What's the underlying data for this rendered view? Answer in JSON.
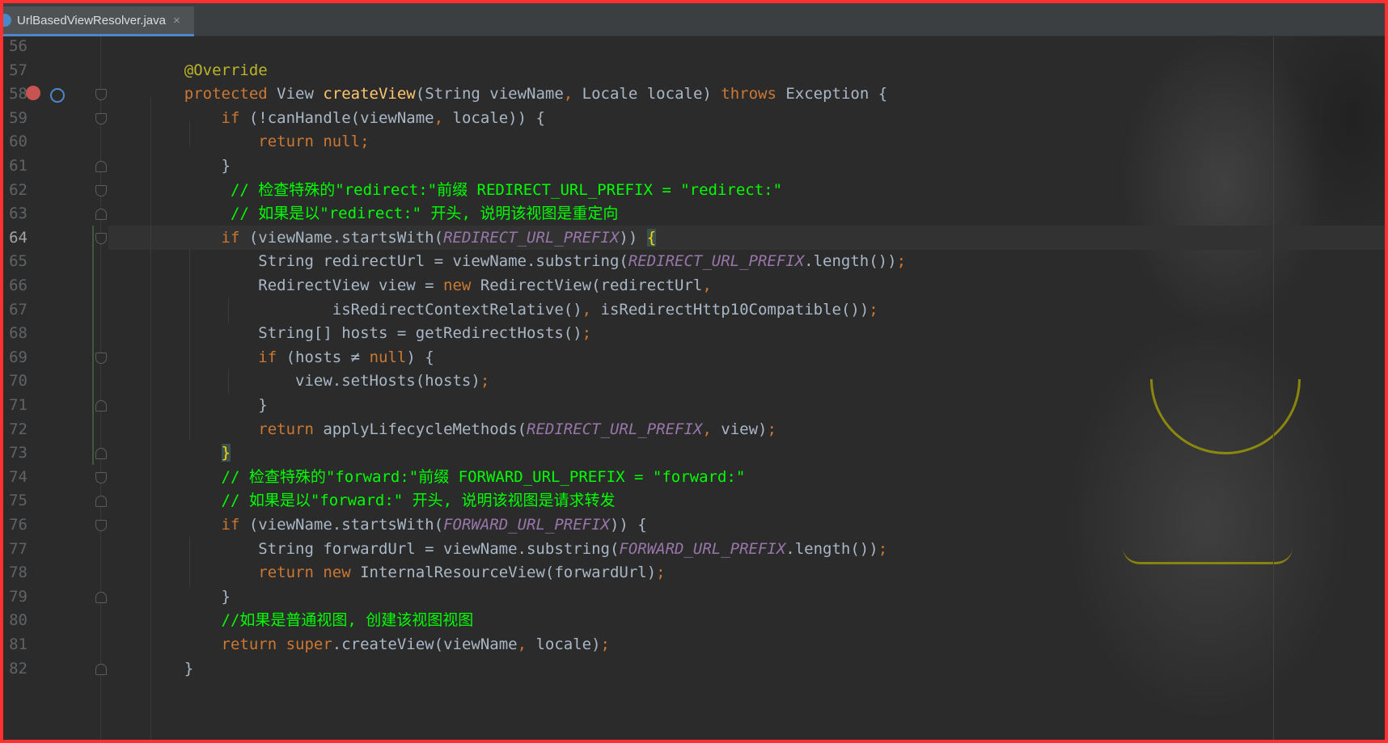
{
  "tab": {
    "filename": "UrlBasedViewResolver.java",
    "close": "×"
  },
  "lines": [
    {
      "no": "56",
      "segs": []
    },
    {
      "no": "57",
      "segs": [
        {
          "t": "    @Override",
          "c": "a"
        }
      ]
    },
    {
      "no": "58",
      "segs": [
        {
          "t": "    ",
          "c": ""
        },
        {
          "t": "protected",
          "c": "k"
        },
        {
          "t": " View ",
          "c": ""
        },
        {
          "t": "createView",
          "c": "f"
        },
        {
          "t": "(String viewName",
          "c": ""
        },
        {
          "t": ",",
          "c": "k"
        },
        {
          "t": " Locale locale) ",
          "c": ""
        },
        {
          "t": "throws",
          "c": "k"
        },
        {
          "t": " Exception {",
          "c": ""
        }
      ]
    },
    {
      "no": "59",
      "segs": [
        {
          "t": "        ",
          "c": ""
        },
        {
          "t": "if",
          "c": "k"
        },
        {
          "t": " (!canHandle(viewName",
          "c": ""
        },
        {
          "t": ",",
          "c": "k"
        },
        {
          "t": " locale)) {",
          "c": ""
        }
      ]
    },
    {
      "no": "60",
      "segs": [
        {
          "t": "            ",
          "c": ""
        },
        {
          "t": "return null;",
          "c": "k"
        }
      ]
    },
    {
      "no": "61",
      "segs": [
        {
          "t": "        }",
          "c": ""
        }
      ]
    },
    {
      "no": "62",
      "segs": [
        {
          "t": "         ",
          "c": ""
        },
        {
          "t": "// 检查特殊的\"redirect:\"前缀 REDIRECT_URL_PREFIX = \"redirect:\"",
          "c": "c"
        }
      ]
    },
    {
      "no": "63",
      "segs": [
        {
          "t": "         ",
          "c": ""
        },
        {
          "t": "// 如果是以\"redirect:\" 开头, 说明该视图是重定向",
          "c": "c"
        }
      ]
    },
    {
      "no": "64",
      "segs": [
        {
          "t": "        ",
          "c": ""
        },
        {
          "t": "if",
          "c": "k"
        },
        {
          "t": " (viewName.startsWith(",
          "c": ""
        },
        {
          "t": "REDIRECT_URL_PREFIX",
          "c": "s"
        },
        {
          "t": ")) ",
          "c": ""
        },
        {
          "t": "{",
          "c": "m"
        }
      ]
    },
    {
      "no": "65",
      "segs": [
        {
          "t": "            String redirectUrl = viewName.substring(",
          "c": ""
        },
        {
          "t": "REDIRECT_URL_PREFIX",
          "c": "s"
        },
        {
          "t": ".length())",
          "c": ""
        },
        {
          "t": ";",
          "c": "k"
        }
      ]
    },
    {
      "no": "66",
      "segs": [
        {
          "t": "            RedirectView view = ",
          "c": ""
        },
        {
          "t": "new",
          "c": "k"
        },
        {
          "t": " RedirectView(redirectUrl",
          "c": ""
        },
        {
          "t": ",",
          "c": "k"
        }
      ]
    },
    {
      "no": "67",
      "segs": [
        {
          "t": "                    isRedirectContextRelative()",
          "c": ""
        },
        {
          "t": ",",
          "c": "k"
        },
        {
          "t": " isRedirectHttp10Compatible())",
          "c": ""
        },
        {
          "t": ";",
          "c": "k"
        }
      ]
    },
    {
      "no": "68",
      "segs": [
        {
          "t": "            String[] hosts = getRedirectHosts()",
          "c": ""
        },
        {
          "t": ";",
          "c": "k"
        }
      ]
    },
    {
      "no": "69",
      "segs": [
        {
          "t": "            ",
          "c": ""
        },
        {
          "t": "if",
          "c": "k"
        },
        {
          "t": " (hosts ≠ ",
          "c": ""
        },
        {
          "t": "null",
          "c": "k"
        },
        {
          "t": ") {",
          "c": ""
        }
      ]
    },
    {
      "no": "70",
      "segs": [
        {
          "t": "                view.setHosts(hosts)",
          "c": ""
        },
        {
          "t": ";",
          "c": "k"
        }
      ]
    },
    {
      "no": "71",
      "segs": [
        {
          "t": "            }",
          "c": ""
        }
      ]
    },
    {
      "no": "72",
      "segs": [
        {
          "t": "            ",
          "c": ""
        },
        {
          "t": "return",
          "c": "k"
        },
        {
          "t": " applyLifecycleMethods(",
          "c": ""
        },
        {
          "t": "REDIRECT_URL_PREFIX",
          "c": "s"
        },
        {
          "t": ",",
          "c": "k"
        },
        {
          "t": " view)",
          "c": ""
        },
        {
          "t": ";",
          "c": "k"
        }
      ]
    },
    {
      "no": "73",
      "segs": [
        {
          "t": "        ",
          "c": ""
        },
        {
          "t": "}",
          "c": "m"
        }
      ]
    },
    {
      "no": "74",
      "segs": [
        {
          "t": "        ",
          "c": ""
        },
        {
          "t": "// 检查特殊的\"forward:\"前缀 FORWARD_URL_PREFIX = \"forward:\"",
          "c": "c"
        }
      ]
    },
    {
      "no": "75",
      "segs": [
        {
          "t": "        ",
          "c": ""
        },
        {
          "t": "// 如果是以\"forward:\" 开头, 说明该视图是请求转发",
          "c": "c"
        }
      ]
    },
    {
      "no": "76",
      "segs": [
        {
          "t": "        ",
          "c": ""
        },
        {
          "t": "if",
          "c": "k"
        },
        {
          "t": " (viewName.startsWith(",
          "c": ""
        },
        {
          "t": "FORWARD_URL_PREFIX",
          "c": "s"
        },
        {
          "t": ")) {",
          "c": ""
        }
      ]
    },
    {
      "no": "77",
      "segs": [
        {
          "t": "            String forwardUrl = viewName.substring(",
          "c": ""
        },
        {
          "t": "FORWARD_URL_PREFIX",
          "c": "s"
        },
        {
          "t": ".length())",
          "c": ""
        },
        {
          "t": ";",
          "c": "k"
        }
      ]
    },
    {
      "no": "78",
      "segs": [
        {
          "t": "            ",
          "c": ""
        },
        {
          "t": "return new",
          "c": "k"
        },
        {
          "t": " InternalResourceView(forwardUrl)",
          "c": ""
        },
        {
          "t": ";",
          "c": "k"
        }
      ]
    },
    {
      "no": "79",
      "segs": [
        {
          "t": "        }",
          "c": ""
        }
      ]
    },
    {
      "no": "80",
      "segs": [
        {
          "t": "        ",
          "c": ""
        },
        {
          "t": "//如果是普通视图, 创建该视图视图",
          "c": "c"
        }
      ]
    },
    {
      "no": "81",
      "segs": [
        {
          "t": "        ",
          "c": ""
        },
        {
          "t": "return super",
          "c": "k"
        },
        {
          "t": ".createView(viewName",
          "c": ""
        },
        {
          "t": ",",
          "c": "k"
        },
        {
          "t": " locale)",
          "c": ""
        },
        {
          "t": ";",
          "c": "k"
        }
      ]
    },
    {
      "no": "82",
      "segs": [
        {
          "t": "    }",
          "c": ""
        }
      ]
    }
  ],
  "folds": {
    "58": "open",
    "59": "open",
    "61": "close",
    "62": "open",
    "63": "close",
    "64": "open",
    "69": "open",
    "71": "close",
    "73": "close",
    "74": "open",
    "75": "close",
    "76": "open",
    "79": "close",
    "82": "close"
  },
  "current_line": "64",
  "gutter_icons": [
    {
      "line": "58",
      "name": "override-method-icon",
      "color": "#c75450"
    },
    {
      "line": "58",
      "name": "implementing-method-icon",
      "color": "#4a88c7"
    }
  ]
}
